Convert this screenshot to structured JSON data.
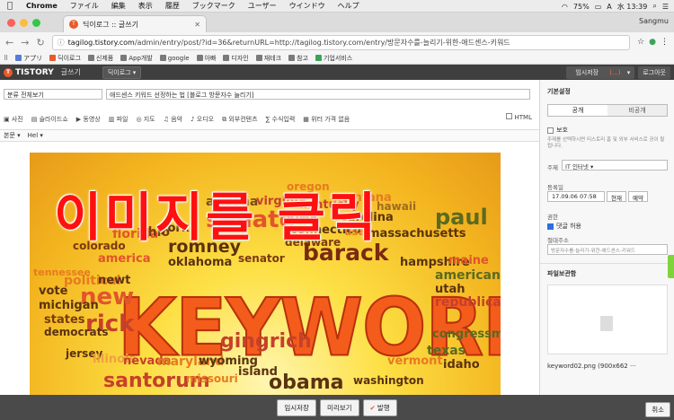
{
  "menubar": {
    "apple": "",
    "items": [
      "Chrome",
      "ファイル",
      "編集",
      "表示",
      "履歴",
      "ブックマーク",
      "ユーザー",
      "ウインドウ",
      "ヘルプ"
    ],
    "battery": "75%",
    "input_mode": "A",
    "clock": "水 13:39"
  },
  "browser": {
    "tab_title": "딕이로그 :: 글쓰기",
    "tab_favicon": "T",
    "profile": "Sangmu",
    "url_host": "tagilog.tistory.com",
    "url_rest": "/admin/entry/post/?id=36&returnURL=http://tagilog.tistory.com/entry/방문자수를-늘리기-위한-애드센스-키워드",
    "bookmarks": [
      {
        "label": "アプリ",
        "color": "#5b7bd5"
      },
      {
        "label": "딕이로그",
        "color": "#ea5a2a"
      },
      {
        "label": "신제품",
        "color": "#7a7a7a"
      },
      {
        "label": "App개발",
        "color": "#7a7a7a"
      },
      {
        "label": "google",
        "color": "#7a7a7a"
      },
      {
        "label": "아빠",
        "color": "#7a7a7a"
      },
      {
        "label": "디자인",
        "color": "#7a7a7a"
      },
      {
        "label": "재테크",
        "color": "#7a7a7a"
      },
      {
        "label": "참고",
        "color": "#7a7a7a"
      },
      {
        "label": "기업서비스",
        "color": "#3aa55a"
      }
    ]
  },
  "tistory": {
    "logo": "TISTORY",
    "logo_badge": "T",
    "sub": "글쓰기",
    "blog_select": "딕이로그",
    "draft_label": "임시저장",
    "draft_count": "(...)",
    "logout": "로그아웃"
  },
  "editor": {
    "category": "분류 전체보기",
    "title": "애드센스 키워드 선정하는 법 [블로그 방문자수 늘리기]",
    "tools": [
      "사진",
      "슬라이드쇼",
      "동영상",
      "파일",
      "지도",
      "음악",
      "오디오",
      "외부컨텐츠",
      "수식입력",
      "위터 가격 없음"
    ],
    "html_label": "HTML",
    "format": [
      "본문",
      "Hel"
    ],
    "overlay_text": "이미지를 클릭",
    "image_big_word": "KEYWORD"
  },
  "wordcloud": [
    {
      "t": "arizona",
      "c": "#7a4a1a"
    },
    {
      "t": "virginia",
      "c": "#c6402a"
    },
    {
      "t": "oregon",
      "c": "#e77a20"
    },
    {
      "t": "montana",
      "c": "#e77a20"
    },
    {
      "t": "hawaii",
      "c": "#a06a20"
    },
    {
      "t": "senate",
      "c": "#e2542a"
    },
    {
      "t": "iowa",
      "c": "#5a3210"
    },
    {
      "t": "kentucky",
      "c": "#c6402a"
    },
    {
      "t": "carolina",
      "c": "#5a3210"
    },
    {
      "t": "paul",
      "c": "#5a6a20"
    },
    {
      "t": "florida",
      "c": "#e2542a"
    },
    {
      "t": "ohio",
      "c": "#7a3a10"
    },
    {
      "t": "york",
      "c": "#5a3210"
    },
    {
      "t": "connecticut",
      "c": "#5a3210"
    },
    {
      "t": "usa",
      "c": "#e77a20"
    },
    {
      "t": "massachusetts",
      "c": "#5a3210"
    },
    {
      "t": "colorado",
      "c": "#7a3a10"
    },
    {
      "t": "romney",
      "c": "#5a3210"
    },
    {
      "t": "delaware",
      "c": "#7a3a10"
    },
    {
      "t": "barack",
      "c": "#7a2a10"
    },
    {
      "t": "america",
      "c": "#e2542a"
    },
    {
      "t": "oklahoma",
      "c": "#5a3210"
    },
    {
      "t": "senator",
      "c": "#7a3a10"
    },
    {
      "t": "hampshire",
      "c": "#5a3210"
    },
    {
      "t": "maine",
      "c": "#e2542a"
    },
    {
      "t": "tennessee",
      "c": "#e77a20"
    },
    {
      "t": "political",
      "c": "#e77a20"
    },
    {
      "t": "newt",
      "c": "#5a3210"
    },
    {
      "t": "american",
      "c": "#5a6a20"
    },
    {
      "t": "vote",
      "c": "#5a3210"
    },
    {
      "t": "new",
      "c": "#e2542a"
    },
    {
      "t": "utah",
      "c": "#5a3210"
    },
    {
      "t": "michigan",
      "c": "#5a3210"
    },
    {
      "t": "republicans",
      "c": "#c6402a"
    },
    {
      "t": "states",
      "c": "#7a3a10"
    },
    {
      "t": "rick",
      "c": "#c6402a"
    },
    {
      "t": "democrats",
      "c": "#5a3210"
    },
    {
      "t": "congressmen",
      "c": "#5a6a20"
    },
    {
      "t": "texas",
      "c": "#5a6a20"
    },
    {
      "t": "jersey",
      "c": "#5a3210"
    },
    {
      "t": "gingrich",
      "c": "#c6402a"
    },
    {
      "t": "illinois",
      "c": "#f0a040"
    },
    {
      "t": "nevada",
      "c": "#c6402a"
    },
    {
      "t": "maryland",
      "c": "#e77a20"
    },
    {
      "t": "wyoming",
      "c": "#5a3210"
    },
    {
      "t": "vermont",
      "c": "#e77a20"
    },
    {
      "t": "idaho",
      "c": "#5a3210"
    },
    {
      "t": "island",
      "c": "#5a3210"
    },
    {
      "t": "santorum",
      "c": "#c6402a"
    },
    {
      "t": "missouri",
      "c": "#e77a20"
    },
    {
      "t": "obama",
      "c": "#5a3210"
    },
    {
      "t": "washington",
      "c": "#5a3210"
    }
  ],
  "panel": {
    "title": "기본설정",
    "visibility": [
      "공개",
      "비공개"
    ],
    "protect_label": "보호",
    "protect_note": "주제를 선택하시면 티스토리 홈 및 외부 서비스로 공이 될 됩니다.",
    "subject_label": "주제",
    "subject_value": "IT 인터넷",
    "date_label": "등록일",
    "date_value": "17.09.06 07:58",
    "date_now": "현재",
    "date_reserve": "예약",
    "perm_label": "권한",
    "comment_label": "댓글 허용",
    "slug_label": "절대주소",
    "slug_value": "방문자수를-늘리기-위한-애드센스-키워드",
    "files_label": "파일보관함",
    "file_name": "keyword02.png (900x662 ···"
  },
  "bottom": {
    "save": "임시저장",
    "preview": "미리보기",
    "publish": "발행",
    "cancel": "취소"
  }
}
